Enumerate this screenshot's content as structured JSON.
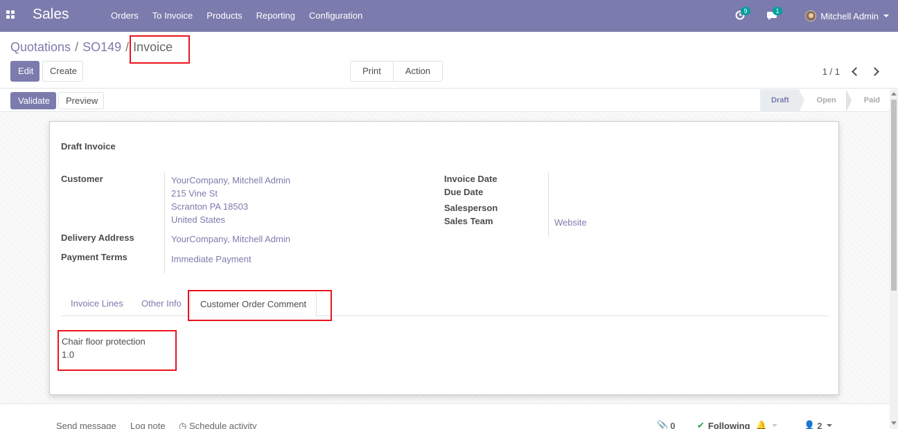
{
  "navbar": {
    "brand": "Sales",
    "menu": [
      "Orders",
      "To Invoice",
      "Products",
      "Reporting",
      "Configuration"
    ],
    "activity_count": "9",
    "message_count": "1",
    "user_name": "Mitchell Admin"
  },
  "breadcrumb": {
    "quotations": "Quotations",
    "order": "SO149",
    "current": "Invoice"
  },
  "buttons": {
    "edit": "Edit",
    "create": "Create",
    "print": "Print",
    "action": "Action",
    "validate": "Validate",
    "preview": "Preview"
  },
  "pager": {
    "value": "1 / 1"
  },
  "status": {
    "steps": [
      "Draft",
      "Open",
      "Paid"
    ],
    "active": "Draft"
  },
  "invoice": {
    "title": "Draft Invoice",
    "customer_label": "Customer",
    "customer_lines": [
      "YourCompany, Mitchell Admin",
      "215 Vine St",
      "Scranton PA 18503",
      "United States"
    ],
    "delivery_label": "Delivery Address",
    "delivery_value": "YourCompany, Mitchell Admin",
    "payment_terms_label": "Payment Terms",
    "payment_terms_value": "Immediate Payment",
    "invoice_date_label": "Invoice Date",
    "due_date_label": "Due Date",
    "salesperson_label": "Salesperson",
    "sales_team_label": "Sales Team",
    "sales_team_value": "Website"
  },
  "tabs": [
    "Invoice Lines",
    "Other Info",
    "Customer Order Comment"
  ],
  "active_tab": "Customer Order Comment",
  "comment": {
    "line1": "Chair floor protection",
    "line2": "1.0"
  },
  "chatter": {
    "send_message": "Send message",
    "log_note": "Log note",
    "schedule_activity": "Schedule activity",
    "attachments": "0",
    "following": "Following",
    "followers": "2"
  },
  "colors": {
    "brand": "#7c7bad",
    "highlight": "#e8141c",
    "badge": "#00a09d"
  }
}
